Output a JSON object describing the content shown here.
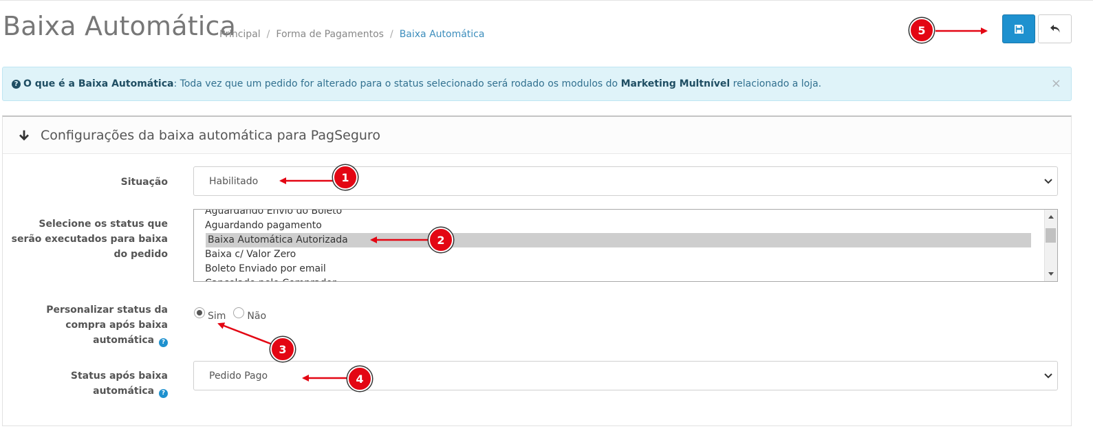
{
  "header": {
    "title": "Baixa Automática",
    "breadcrumb": [
      "Principal",
      "Forma de Pagamentos",
      "Baixa Automática"
    ],
    "breadcrumb_separator": "/"
  },
  "toolbar": {
    "save_icon": "floppy-disk-icon",
    "back_icon": "reply-arrow-icon",
    "save_color": "#1e91cf"
  },
  "alert": {
    "icon": "question-circle-icon",
    "lead": "O que é a Baixa Automática",
    "text_1": ": Toda vez que um pedido for alterado para o status selecionado será rodado os modulos do ",
    "highlight": "Marketing Multnível",
    "text_2": " relacionado a loja.",
    "close_symbol": "×"
  },
  "panel": {
    "icon": "arrow-down-icon",
    "title": "Configurações da baixa automática para PagSeguro"
  },
  "form": {
    "situacao": {
      "label": "Situação",
      "value": "Habilitado"
    },
    "status_list": {
      "label": "Selecione os status que serão executados para baixa do pedido",
      "options": [
        "Aguardando Envio do Boleto",
        "Aguardando pagamento",
        "Baixa Automática Autorizada",
        "Baixa c/ Valor Zero",
        "Boleto Enviado por email",
        "Cancelado pelo Comprador"
      ],
      "selected": "Baixa Automática Autorizada"
    },
    "personalizar": {
      "label": "Personalizar status da compra após baixa automática",
      "options": [
        "Sim",
        "Não"
      ],
      "selected": "Sim"
    },
    "status_apos": {
      "label": "Status após baixa automática",
      "value": "Pedido Pago"
    },
    "help_symbol": "?"
  },
  "annotations": {
    "callouts": [
      "1",
      "2",
      "3",
      "4",
      "5"
    ],
    "color": "#e30613"
  }
}
